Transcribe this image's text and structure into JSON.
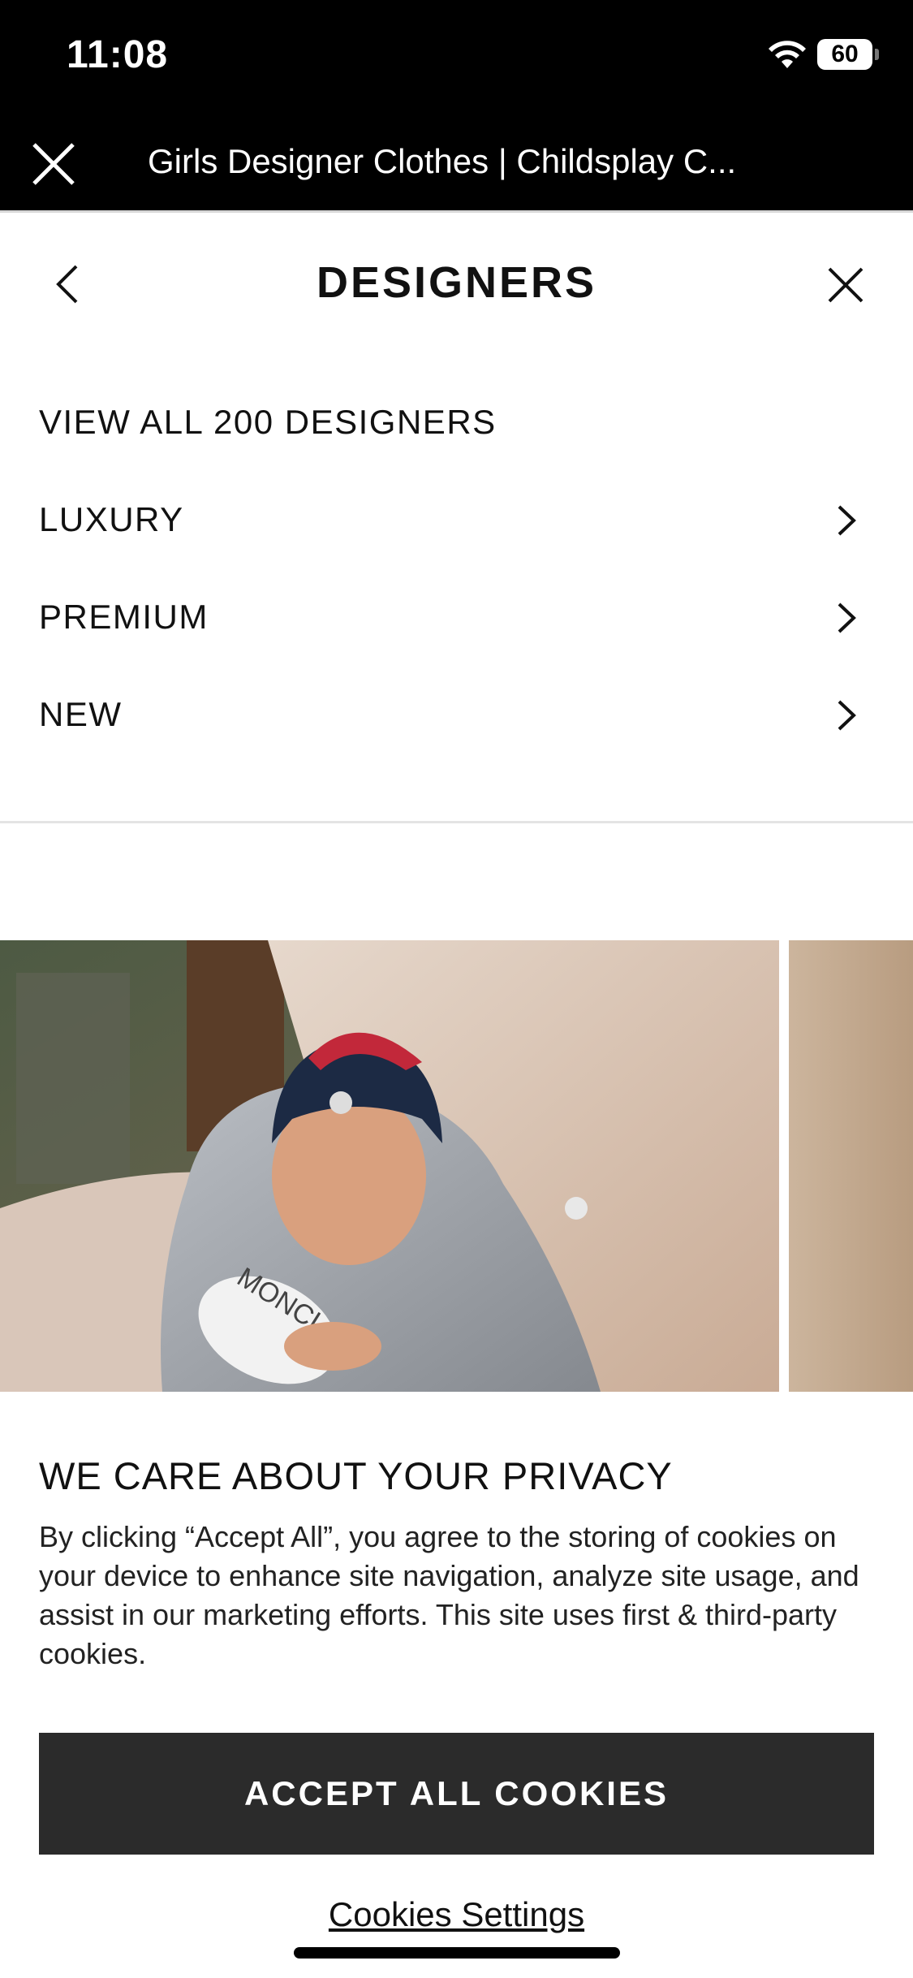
{
  "status_bar": {
    "time": "11:08",
    "battery": "60",
    "icons": [
      "wifi-icon",
      "battery-icon"
    ]
  },
  "browser": {
    "title": "Girls Designer Clothes | Childsplay C...",
    "close_icon": "close-icon"
  },
  "menu": {
    "title": "DESIGNERS",
    "items": [
      {
        "label": "VIEW ALL 200 DESIGNERS",
        "has_chevron": false
      },
      {
        "label": "LUXURY",
        "has_chevron": true
      },
      {
        "label": "PREMIUM",
        "has_chevron": true
      },
      {
        "label": "NEW",
        "has_chevron": true
      }
    ]
  },
  "banner": {
    "image_description": "child in grey puffer jacket and navy beanie holding sneakers",
    "logo_text": "MONCLER"
  },
  "privacy": {
    "title": "WE CARE ABOUT YOUR PRIVACY",
    "body": "By clicking “Accept All”, you agree to the storing of cookies on your device to enhance site navigation, analyze site usage, and assist in our marketing efforts. This site uses first & third-party cookies.",
    "accept_label": "ACCEPT ALL COOKIES",
    "settings_label": "Cookies Settings"
  },
  "colors": {
    "top_bar": "#000000",
    "button": "#2b2b2b",
    "background": "#ffffff"
  }
}
